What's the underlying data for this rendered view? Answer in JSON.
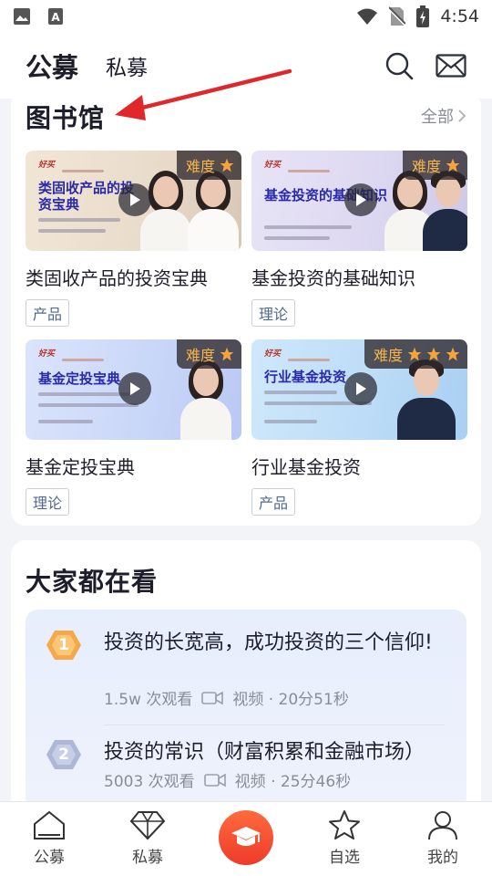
{
  "status_bar": {
    "time": "4:54"
  },
  "header": {
    "tab_public": "公募",
    "tab_private": "私募"
  },
  "library": {
    "title": "图书馆",
    "view_all": "全部",
    "courses": [
      {
        "title": "类固收产品的投资宝典",
        "tag": "产品",
        "difficulty_label": "难度",
        "stars": 1,
        "cover_brand": "好买",
        "cover_headline": "类固收产品的投资宝典"
      },
      {
        "title": "基金投资的基础知识",
        "tag": "理论",
        "difficulty_label": "难度",
        "stars": 1,
        "cover_brand": "好买",
        "cover_headline": "基金投资的基础知识"
      },
      {
        "title": "基金定投宝典",
        "tag": "理论",
        "difficulty_label": "难度",
        "stars": 1,
        "cover_brand": "好买",
        "cover_headline": "基金定投宝典"
      },
      {
        "title": "行业基金投资",
        "tag": "产品",
        "difficulty_label": "难度",
        "stars": 3,
        "cover_brand": "好买",
        "cover_headline": "行业基金投资"
      }
    ]
  },
  "watching": {
    "title": "大家都在看",
    "items": [
      {
        "rank": "1",
        "title": "投资的长宽高，成功投资的三个信仰!",
        "views": "1.5w 次观看",
        "type_duration": "视频 · 20分51秒"
      },
      {
        "rank": "2",
        "title": "投资的常识（财富积累和金融市场）",
        "views": "5003 次观看",
        "type_duration": "视频 · 25分46秒"
      }
    ]
  },
  "bottom_nav": [
    {
      "label": "公募",
      "icon": "home-icon"
    },
    {
      "label": "私募",
      "icon": "diamond-icon"
    },
    {
      "label": "",
      "icon": "graduation-cap-icon"
    },
    {
      "label": "自选",
      "icon": "star-icon"
    },
    {
      "label": "我的",
      "icon": "user-icon"
    }
  ],
  "colors": {
    "accent": "#ee3b2b",
    "star": "#f6a43a",
    "tag_text": "#4f6a92",
    "rank1": "#f5a94a",
    "rank2": "#aeb7d6",
    "annotation_arrow": "#e0282a"
  }
}
